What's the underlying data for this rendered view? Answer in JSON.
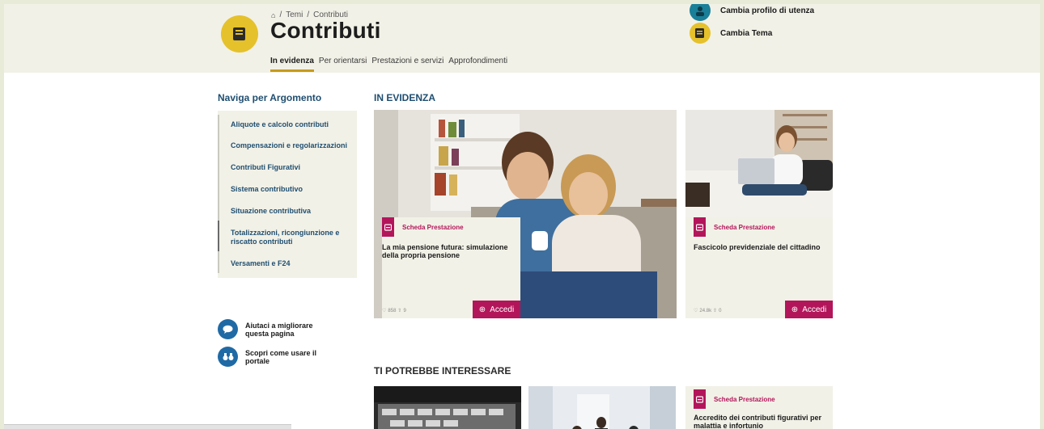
{
  "breadcrumb": [
    "Temi",
    "Contributi"
  ],
  "header": {
    "title": "Contributi",
    "tabs": [
      {
        "label": "In evidenza",
        "active": true
      },
      {
        "label": "Per orientarsi",
        "active": false
      },
      {
        "label": "Prestazioni e servizi",
        "active": false
      },
      {
        "label": "Approfondimenti",
        "active": false
      }
    ],
    "change_profile": "Cambia profilo di utenza",
    "change_theme": "Cambia Tema"
  },
  "sidebar": {
    "title": "Naviga per Argomento",
    "items": [
      "Aliquote e calcolo contributi",
      "Compensazioni e regolarizzazioni",
      "Contributi Figurativi",
      "Sistema contributivo",
      "Situazione contributiva",
      "Totalizzazioni, ricongiunzione e riscatto contributi",
      "Versamenti e F24"
    ],
    "help": [
      {
        "label": "Aiutaci a migliorare questa pagina",
        "icon": "speech-bubble-icon"
      },
      {
        "label": "Scopri come usare il portale",
        "icon": "binoculars-icon"
      }
    ]
  },
  "highlights": {
    "title": "IN EVIDENZA",
    "cards": [
      {
        "tag": "Scheda Prestazione",
        "title": "La mia pensione futura: simulazione della propria pensione",
        "likes": "858",
        "shares": "9",
        "button": "Accedi"
      },
      {
        "tag": "Scheda Prestazione",
        "title": "Fascicolo previdenziale del cittadino",
        "likes": "24.8k",
        "shares": "0",
        "button": "Accedi"
      }
    ]
  },
  "suggested": {
    "title": "TI POTREBBE INTERESSARE",
    "card": {
      "tag": "Scheda Prestazione",
      "title": "Accredito dei contributi figurativi per malattia e infortunio"
    }
  },
  "colors": {
    "accent": "#b3155a",
    "theme": "#e5c12b",
    "link": "#1f4e70",
    "info": "#1f6aa5"
  }
}
